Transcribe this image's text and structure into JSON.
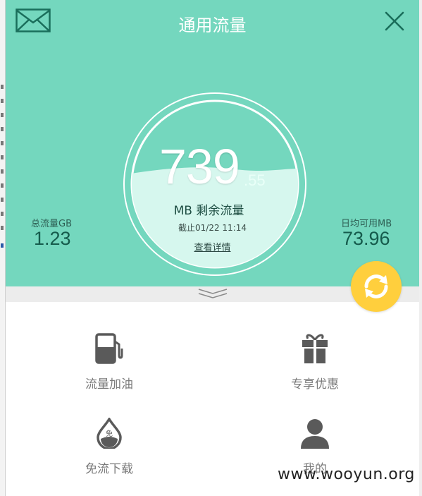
{
  "header": {
    "title": "通用流量"
  },
  "gauge": {
    "remaining_int": "739",
    "remaining_frac": ".55",
    "unit_label": "MB 剩余流量",
    "timestamp": "截止01/22 11:14",
    "detail_link": "查看详情",
    "fill_fraction": 0.55
  },
  "stats": {
    "total_label": "总流量GB",
    "total_value": "1.23",
    "daily_label": "日均可用MB",
    "daily_value": "73.96"
  },
  "menu": [
    {
      "label": "流量加油",
      "icon": "fuel-pump-icon"
    },
    {
      "label": "专享优惠",
      "icon": "gift-icon"
    },
    {
      "label": "免流下载",
      "icon": "water-drop-icon"
    },
    {
      "label": "我的",
      "icon": "user-icon"
    }
  ],
  "watermark": "www.wooyun.org",
  "colors": {
    "hero_bg": "#74d7be",
    "accent_dark": "#155b4c",
    "refresh_button": "#ffcf3d",
    "icon_gray": "#666666"
  }
}
